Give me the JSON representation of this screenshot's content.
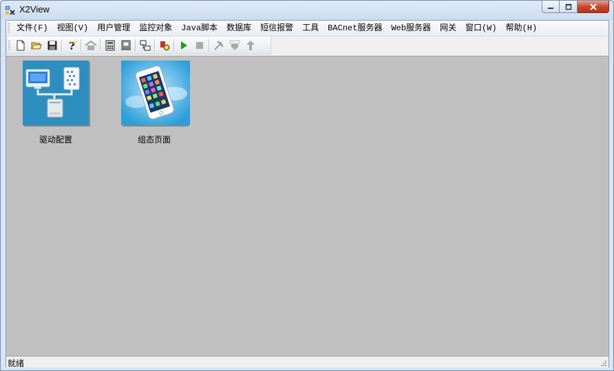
{
  "window": {
    "title": "X2View"
  },
  "menu": [
    "文件(F)",
    "视图(V)",
    "用户管理",
    "监控对象",
    "Java脚本",
    "数据库",
    "短信报警",
    "工具",
    "BACnet服务器",
    "Web服务器",
    "网关",
    "窗口(W)",
    "帮助(H)"
  ],
  "toolbar": {
    "icons": [
      "new-file-icon",
      "open-folder-icon",
      "save-icon",
      "help-icon",
      "home-icon",
      "calculator-icon",
      "monitor-icon",
      "network-icon",
      "tools-config-icon",
      "run-icon",
      "stop-icon",
      "build-icon",
      "load-icon",
      "upload-icon"
    ],
    "run_color": "#1e9b1e"
  },
  "desktop": {
    "background": "#c0c0c0",
    "items": [
      {
        "label": "驱动配置",
        "icon": "driver-config-icon"
      },
      {
        "label": "组态页面",
        "icon": "mobile-page-icon"
      }
    ]
  },
  "status": {
    "text": "就绪"
  }
}
